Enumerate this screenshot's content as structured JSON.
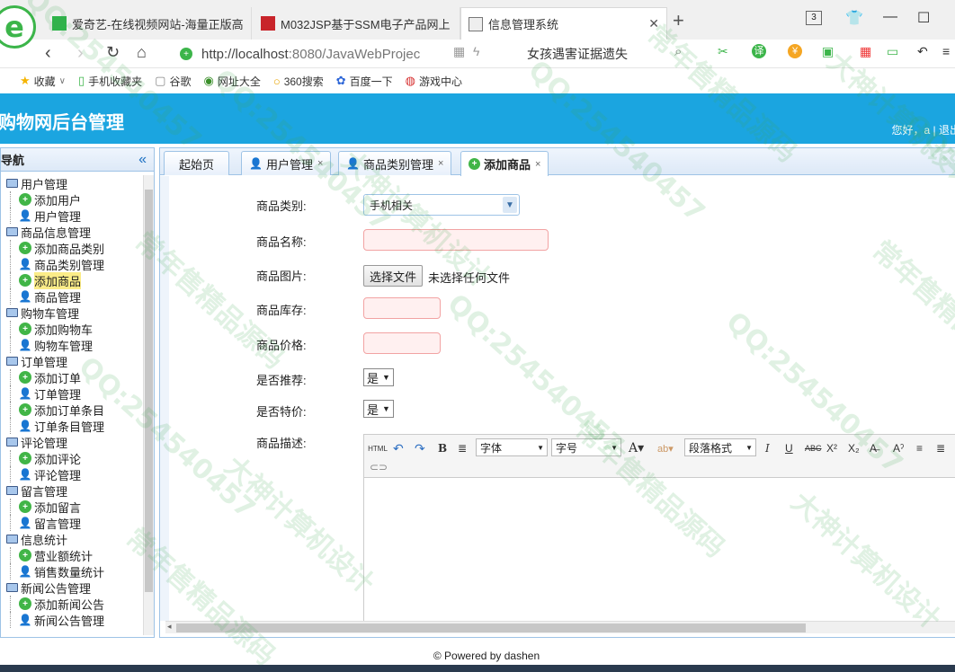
{
  "browser": {
    "tabs": [
      {
        "title": "爱奇艺-在线视频网站-海量正版高",
        "active": false
      },
      {
        "title": "M032JSP基于SSM电子产品网上",
        "active": false
      },
      {
        "title": "信息管理系统",
        "active": true
      }
    ],
    "tab_count": "3",
    "url_host": "http://localhost",
    "url_rest": ":8080/JavaWebProjec",
    "search_text": "女孩遇害证据遗失",
    "bookmarks": [
      "收藏",
      "手机收藏夹",
      "谷歌",
      "网址大全",
      "360搜索",
      "百度一下",
      "游戏中心"
    ]
  },
  "app": {
    "title": "购物网后台管理",
    "greeting": "您好，a | 退出"
  },
  "sidebar": {
    "title": "导航",
    "groups": [
      {
        "label": "用户管理",
        "items": [
          {
            "label": "添加用户",
            "icon": "add"
          },
          {
            "label": "用户管理",
            "icon": "user"
          }
        ]
      },
      {
        "label": "商品信息管理",
        "items": [
          {
            "label": "添加商品类别",
            "icon": "add"
          },
          {
            "label": "商品类别管理",
            "icon": "user"
          },
          {
            "label": "添加商品",
            "icon": "add",
            "selected": true
          },
          {
            "label": "商品管理",
            "icon": "user"
          }
        ]
      },
      {
        "label": "购物车管理",
        "items": [
          {
            "label": "添加购物车",
            "icon": "add"
          },
          {
            "label": "购物车管理",
            "icon": "user"
          }
        ]
      },
      {
        "label": "订单管理",
        "items": [
          {
            "label": "添加订单",
            "icon": "add"
          },
          {
            "label": "订单管理",
            "icon": "user"
          },
          {
            "label": "添加订单条目",
            "icon": "add"
          },
          {
            "label": "订单条目管理",
            "icon": "user"
          }
        ]
      },
      {
        "label": "评论管理",
        "items": [
          {
            "label": "添加评论",
            "icon": "add"
          },
          {
            "label": "评论管理",
            "icon": "user"
          }
        ]
      },
      {
        "label": "留言管理",
        "items": [
          {
            "label": "添加留言",
            "icon": "add"
          },
          {
            "label": "留言管理",
            "icon": "user"
          }
        ]
      },
      {
        "label": "信息统计",
        "items": [
          {
            "label": "营业额统计",
            "icon": "add"
          },
          {
            "label": "销售数量统计",
            "icon": "user"
          }
        ]
      },
      {
        "label": "新闻公告管理",
        "items": [
          {
            "label": "添加新闻公告",
            "icon": "add"
          },
          {
            "label": "新闻公告管理",
            "icon": "user"
          }
        ]
      }
    ]
  },
  "main_tabs": [
    {
      "label": "起始页",
      "closable": false,
      "icon": ""
    },
    {
      "label": "用户管理",
      "closable": true,
      "icon": "user"
    },
    {
      "label": "商品类别管理",
      "closable": true,
      "icon": "user"
    },
    {
      "label": "添加商品",
      "closable": true,
      "icon": "add",
      "active": true
    }
  ],
  "form": {
    "category_label": "商品类别:",
    "category_value": "手机相关",
    "name_label": "商品名称:",
    "image_label": "商品图片:",
    "file_button": "选择文件",
    "file_status": "未选择任何文件",
    "stock_label": "商品库存:",
    "price_label": "商品价格:",
    "recommend_label": "是否推荐:",
    "recommend_value": "是",
    "special_label": "是否特价:",
    "special_value": "是",
    "desc_label": "商品描述:"
  },
  "editor": {
    "font_label": "字体",
    "size_label": "字号",
    "para_label": "段落格式",
    "html_label": "HTML"
  },
  "footer": "© Powered by dashen",
  "watermarks": [
    "QQ:254540457",
    "常年售精品源码",
    "大神计算机设计"
  ]
}
